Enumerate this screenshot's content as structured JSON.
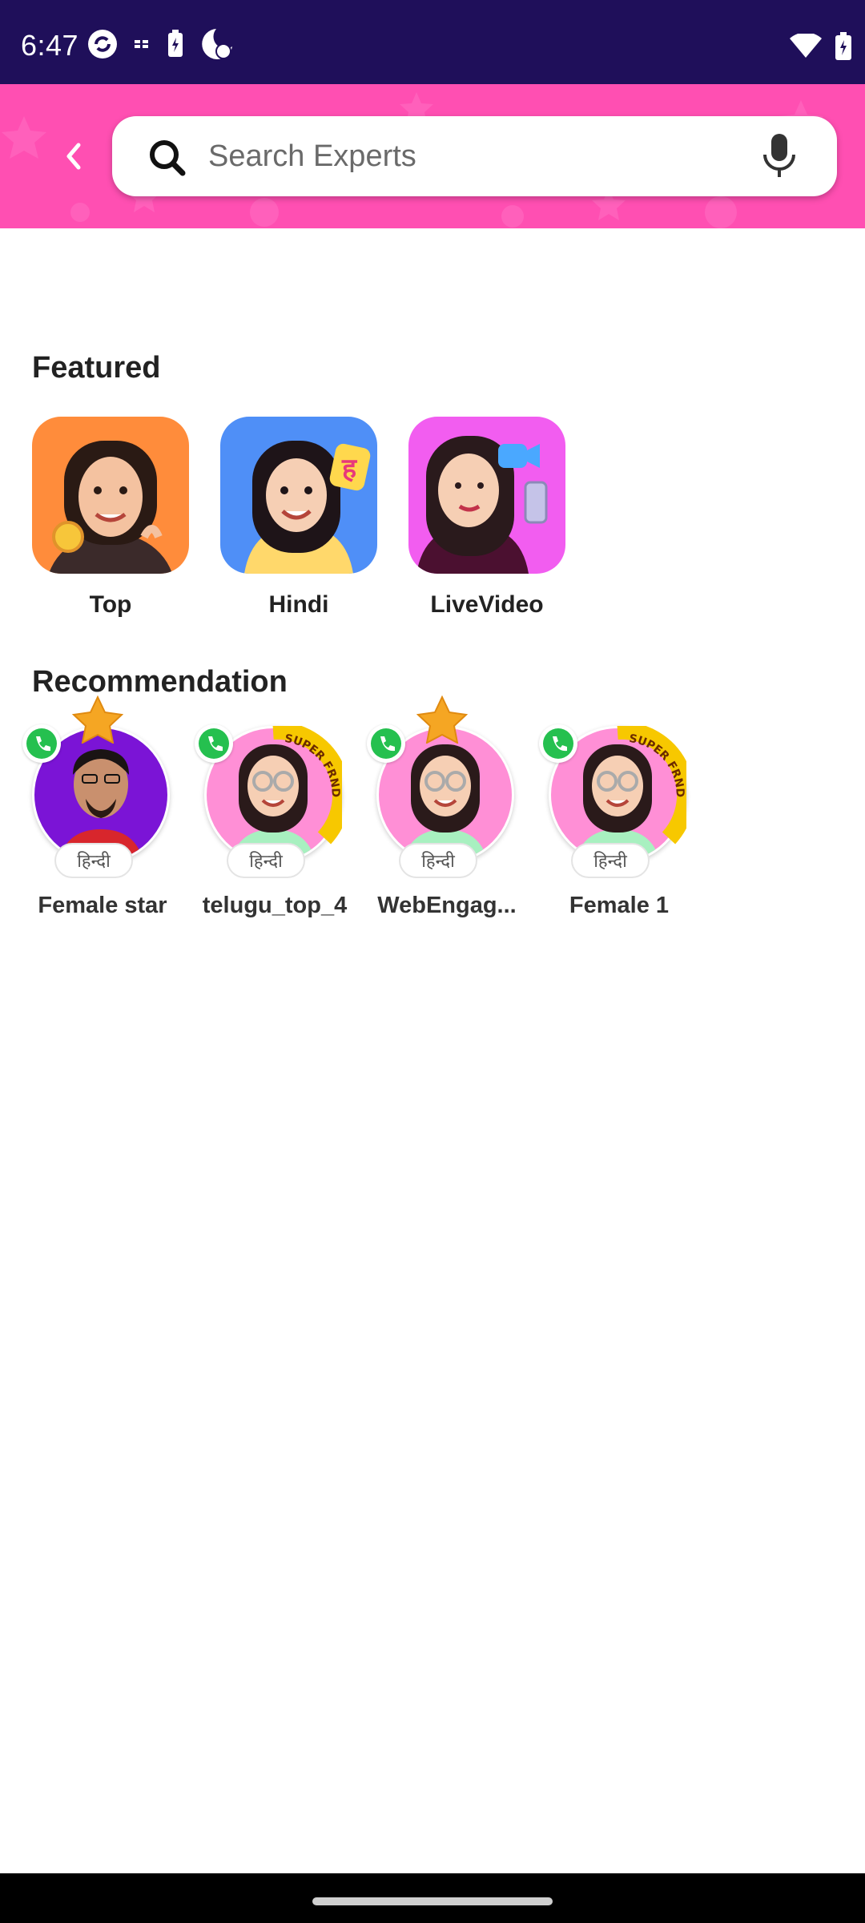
{
  "status_bar": {
    "time": "6:47"
  },
  "search": {
    "placeholder": "Search Experts"
  },
  "featured": {
    "title": "Featured",
    "items": [
      {
        "label": "Top",
        "bg": "#ff8c3b"
      },
      {
        "label": "Hindi",
        "bg": "#4f8ff7"
      },
      {
        "label": "LiveVideo",
        "bg": "#f25df0"
      }
    ]
  },
  "recommendation": {
    "title": "Recommendation",
    "items": [
      {
        "name": "Female star",
        "language": "हिन्दी",
        "starred": true,
        "super_frnd": false,
        "bg": "#7b14d6"
      },
      {
        "name": "telugu_top_4",
        "language": "हिन्दी",
        "starred": false,
        "super_frnd": true,
        "bg": "#ff8fd6"
      },
      {
        "name": "WebEngag...",
        "language": "हिन्दी",
        "starred": true,
        "super_frnd": false,
        "bg": "#ff8fd6"
      },
      {
        "name": "Female 1",
        "language": "हिन्दी",
        "starred": false,
        "super_frnd": true,
        "bg": "#ff8fd6"
      }
    ],
    "super_frnd_label": "SUPER FRND"
  },
  "colors": {
    "status_bar": "#1f0f5a",
    "header": "#ff4fb2",
    "call_green": "#25c04f",
    "star_gold": "#f5a623"
  }
}
